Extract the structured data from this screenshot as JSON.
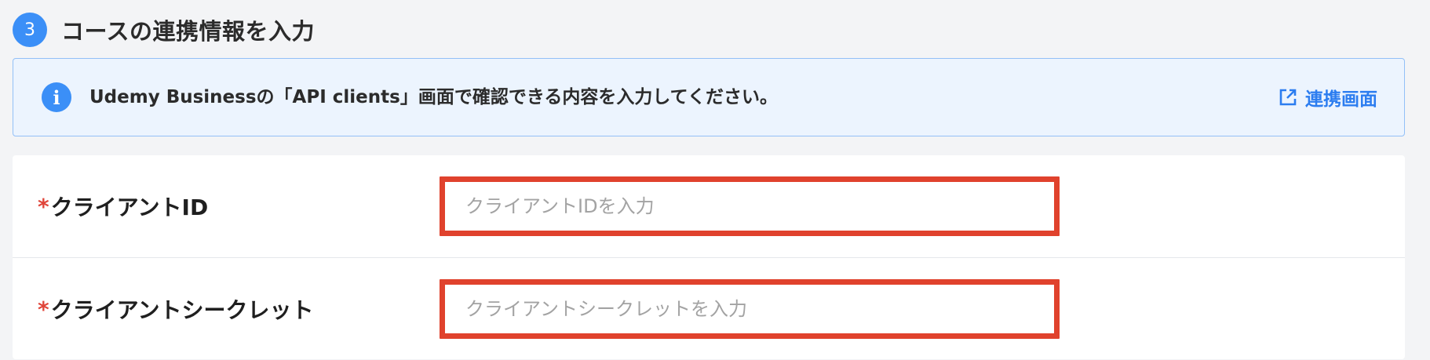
{
  "section": {
    "step_number": "3",
    "title": "コースの連携情報を入力"
  },
  "info_banner": {
    "icon": "info-icon",
    "message": "Udemy Businessの「API clients」画面で確認できる内容を入力してください。",
    "link_icon": "external-link-icon",
    "link_label": "連携画面"
  },
  "form": {
    "required_mark": "*",
    "client_id": {
      "label": "クライアントID",
      "value": "",
      "placeholder": "クライアントIDを入力"
    },
    "client_secret": {
      "label": "クライアントシークレット",
      "value": "",
      "placeholder": "クライアントシークレットを入力"
    }
  },
  "colors": {
    "accent_blue": "#3b8ff7",
    "link_blue": "#2c7df0",
    "banner_background": "#ecf4fe",
    "banner_border": "#93c0f7",
    "required_red": "#e0453a",
    "highlight_border": "#e0422d",
    "page_background": "#f3f4f6"
  }
}
